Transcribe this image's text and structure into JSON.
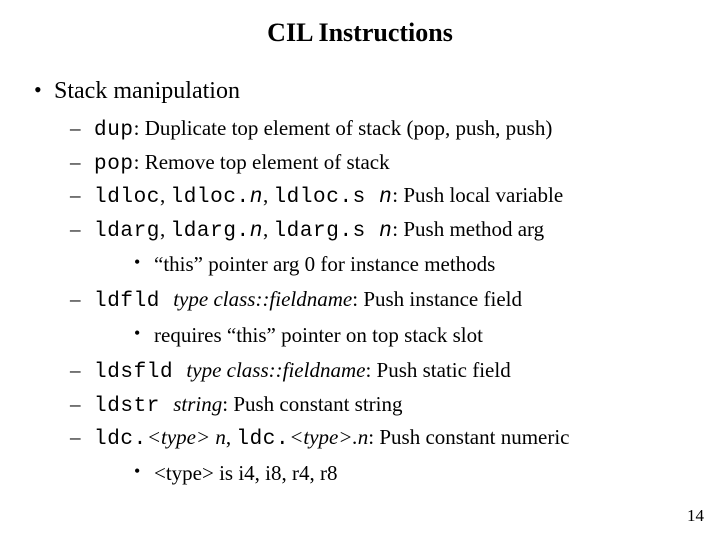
{
  "title": "CIL Instructions",
  "section": "Stack manipulation",
  "items": {
    "dup": {
      "kw": "dup",
      "desc": ": Duplicate top element of stack (pop, push, push)"
    },
    "pop": {
      "kw": "pop",
      "desc": ": Remove top element of stack"
    },
    "ldloc": {
      "k1": "ldloc",
      "c1": ", ",
      "k2": "ldloc.",
      "p2": "n",
      "c2": ", ",
      "k3": "ldloc.s ",
      "p3": "n",
      "desc": ": Push local variable"
    },
    "ldarg": {
      "k1": "ldarg",
      "c1": ", ",
      "k2": "ldarg.",
      "p2": "n",
      "c2": ", ",
      "k3": "ldarg.s ",
      "p3": "n",
      "desc": ": Push method arg"
    },
    "ldarg_note": "“this” pointer arg 0 for instance methods",
    "ldfld": {
      "kw": "ldfld ",
      "param": "type class::fieldname",
      "desc": ": Push instance field"
    },
    "ldfld_note": "requires “this” pointer on top stack slot",
    "ldsfld": {
      "kw": "ldsfld ",
      "param": "type class::fieldname",
      "desc": ": Push static field"
    },
    "ldstr": {
      "kw": "ldstr ",
      "param": "string",
      "desc": ": Push constant string"
    },
    "ldc": {
      "k1": "ldc.",
      "p1": "<type> n",
      "c1": ", ",
      "k2": "ldc.",
      "p2": "<type>.n",
      "desc": ": Push constant numeric"
    },
    "ldc_note": "<type> is i4, i8, r4, r8"
  },
  "page_number": "14"
}
